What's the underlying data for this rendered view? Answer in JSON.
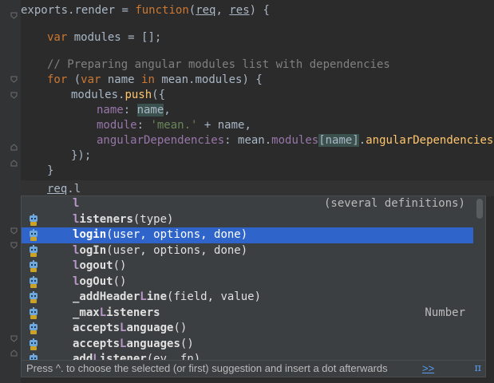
{
  "code": {
    "l1_exports": "exports",
    "l1_dot": ".",
    "l1_render": "render",
    "l1_eq": " = ",
    "l1_function": "function",
    "l1_open": "(",
    "l1_req": "req",
    "l1_comma": ", ",
    "l1_res": "res",
    "l1_close": ") {",
    "l2_var": "var",
    "l2_rest": " modules = [];",
    "l3_comment": "// Preparing angular modules list with dependencies",
    "l4_for": "for",
    "l4_a": " (",
    "l4_var": "var",
    "l4_b": " name ",
    "l4_in": "in",
    "l4_c": " mean.modules) {",
    "l5_a": "modules.",
    "l5_push": "push",
    "l5_b": "({",
    "l6_key": "name",
    "l6_colon": ": ",
    "l6_val": "name",
    "l6_comma": ",",
    "l7_key": "module",
    "l7_colon": ": ",
    "l7_str": "'mean.'",
    "l7_rest": " + name,",
    "l8_key": "angularDependencies",
    "l8_a": ": mean.",
    "l8_modules": "modules",
    "l8_lb": "[",
    "l8_name": "name",
    "l8_rb": "]",
    "l8_dot": ".",
    "l8_prop": "angularDependencies",
    "l9": "});",
    "l10": "}",
    "l11_req": "req",
    "l11_rest": ".l",
    "l_last": "}"
  },
  "completion": {
    "items": [
      {
        "pre": "",
        "match": "l",
        "post": "",
        "params": "",
        "tail": "(several definitions)",
        "icon": "",
        "selected": false
      },
      {
        "pre": "",
        "match": "l",
        "post": "isteners",
        "params": "(type)",
        "tail": "",
        "icon": "field-icon",
        "selected": false
      },
      {
        "pre": "",
        "match": "l",
        "post": "ogin",
        "params": "(user, options, done)",
        "tail": "",
        "icon": "method-icon",
        "selected": true
      },
      {
        "pre": "",
        "match": "l",
        "post": "ogIn",
        "params": "(user, options, done)",
        "tail": "",
        "icon": "method-icon",
        "selected": false
      },
      {
        "pre": "",
        "match": "l",
        "post": "ogout",
        "params": "()",
        "tail": "",
        "icon": "method-icon",
        "selected": false
      },
      {
        "pre": "",
        "match": "l",
        "post": "ogOut",
        "params": "()",
        "tail": "",
        "icon": "method-icon",
        "selected": false
      },
      {
        "pre": "_addHeader",
        "match": "L",
        "post": "ine",
        "params": "(field, value)",
        "tail": "",
        "icon": "method-icon",
        "selected": false
      },
      {
        "pre": "_max",
        "match": "L",
        "post": "isteners",
        "params": "",
        "tail": "Number",
        "icon": "field-icon",
        "selected": false
      },
      {
        "pre": "accepts",
        "match": "L",
        "post": "anguage",
        "params": "()",
        "tail": "",
        "icon": "method-icon",
        "selected": false
      },
      {
        "pre": "accepts",
        "match": "L",
        "post": "anguages",
        "params": "()",
        "tail": "",
        "icon": "method-icon",
        "selected": false
      },
      {
        "pre": "add",
        "match": "L",
        "post": "istener",
        "params": "(ev, fn)",
        "tail": "",
        "icon": "method-icon",
        "selected": false
      }
    ],
    "hint_text": "Press ^. to choose the selected (or first) suggestion and insert a dot afterwards",
    "hint_link": ">>",
    "hint_pi": "π"
  },
  "colors": {
    "background": "#2b2b2b",
    "keyword": "#cc7832",
    "string": "#6a8759",
    "comment": "#808080",
    "property": "#9876aa",
    "function": "#ffc66d",
    "selection": "#2f65ca"
  }
}
